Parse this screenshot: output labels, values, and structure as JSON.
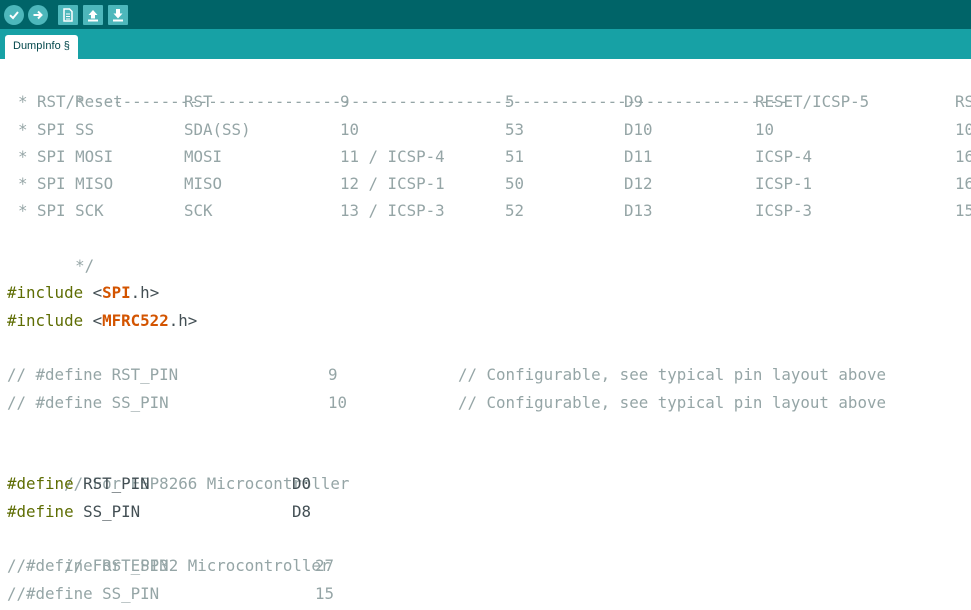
{
  "toolbar": {
    "buttons": [
      {
        "name": "verify-button",
        "icon": "checkmark-icon",
        "shape": "round"
      },
      {
        "name": "upload-button",
        "icon": "arrow-right-icon",
        "shape": "round"
      },
      {
        "name": "new-button",
        "icon": "document-icon",
        "shape": "square"
      },
      {
        "name": "open-button",
        "icon": "arrow-up-icon",
        "shape": "square"
      },
      {
        "name": "save-button",
        "icon": "arrow-down-icon",
        "shape": "square"
      }
    ]
  },
  "tab": {
    "label": "DumpInfo §"
  },
  "comment_table": {
    "divider": "* -------------------------------------------------------------------------",
    "rows": [
      [
        "* RST/Reset",
        "RST",
        "9",
        "5",
        "D9",
        "RESET/ICSP-5",
        "RS"
      ],
      [
        "* SPI SS",
        "SDA(SS)",
        "10",
        "53",
        "D10",
        "10",
        "10"
      ],
      [
        "* SPI MOSI",
        "MOSI",
        "11 / ICSP-4",
        "51",
        "D11",
        "ICSP-4",
        "16"
      ],
      [
        "* SPI MISO",
        "MISO",
        "12 / ICSP-1",
        "50",
        "D12",
        "ICSP-1",
        "16"
      ],
      [
        "* SPI SCK",
        "SCK",
        "13 / ICSP-3",
        "52",
        "D13",
        "ICSP-3",
        "15"
      ]
    ],
    "close": "*/"
  },
  "includes": [
    {
      "directive": "#include",
      "open": "<",
      "lib": "SPI",
      "ext": ".h>"
    },
    {
      "directive": "#include",
      "open": "<",
      "lib": "MFRC522",
      "ext": ".h>"
    }
  ],
  "commented_defines": [
    {
      "def": "// #define RST_PIN",
      "val": "9",
      "comment": "// Configurable, see typical pin layout above"
    },
    {
      "def": "// #define SS_PIN",
      "val": "10",
      "comment": "// Configurable, see typical pin layout above"
    }
  ],
  "esp8266": {
    "comment": "// For ESP8266 Microcontroller",
    "defines": [
      {
        "directive": "#define",
        "name": "RST_PIN",
        "val": "D0"
      },
      {
        "directive": "#define",
        "name": "SS_PIN",
        "val": "D8"
      }
    ]
  },
  "esp32": {
    "comment": "// For ESP32 Microcontroller",
    "defines": [
      {
        "def": "//#define RST_PIN",
        "val": "27"
      },
      {
        "def": "//#define SS_PIN",
        "val": "15"
      }
    ]
  },
  "colors": {
    "toolbar_bg": "#006468",
    "tabbar_bg": "#17a1a5",
    "button_bg": "#4db7bb",
    "comment": "#95a5a6",
    "preprocessor": "#5e6d03",
    "library_keyword": "#d35400",
    "text": "#434f54"
  }
}
